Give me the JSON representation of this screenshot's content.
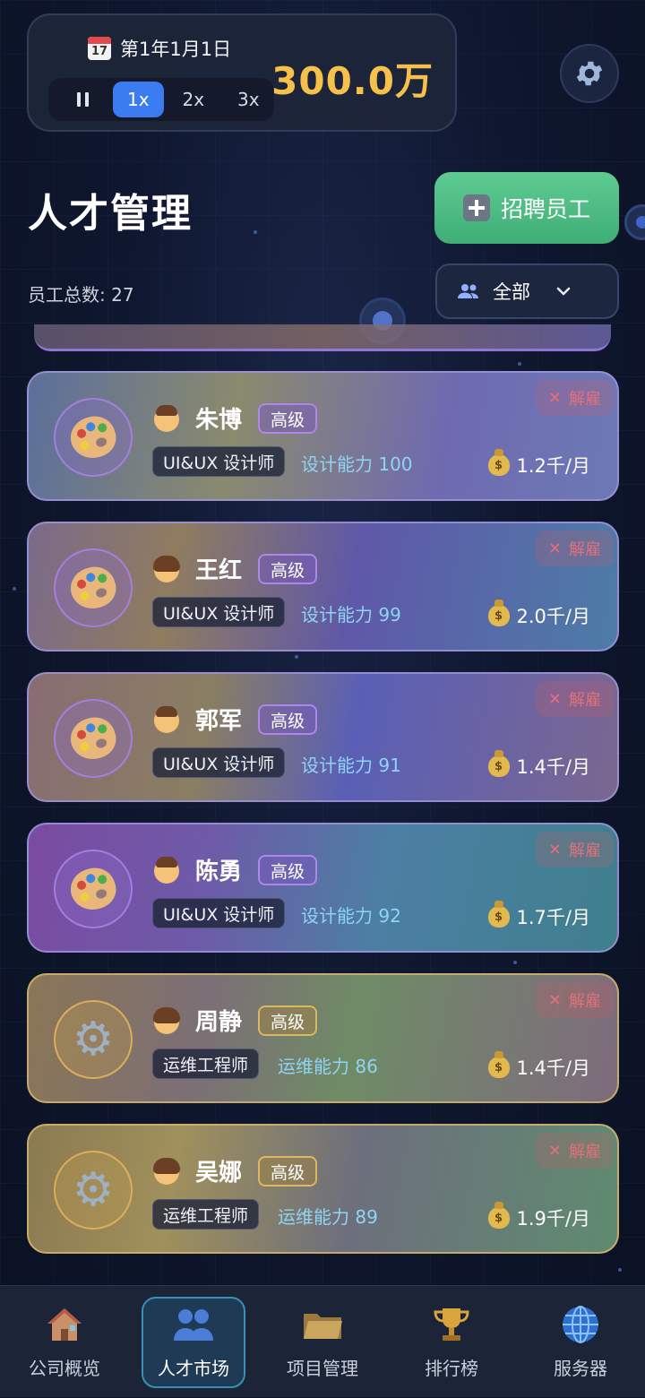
{
  "header": {
    "date": "第1年1月1日",
    "calendar_icon_text": "JULY 17",
    "speeds": [
      "1x",
      "2x",
      "3x"
    ],
    "active_speed": "1x",
    "money": "300.0万"
  },
  "page": {
    "title": "人才管理",
    "recruit_label": "招聘员工",
    "employee_count": "员工总数: 27",
    "filter_label": "全部"
  },
  "employees": [
    {
      "name": "朱博",
      "level": "高级",
      "role": "UI&UX 设计师",
      "skill": "设计能力 100",
      "salary": "1.2千/月",
      "fire": "解雇",
      "gender": "male",
      "icon": "palette-icon"
    },
    {
      "name": "王红",
      "level": "高级",
      "role": "UI&UX 设计师",
      "skill": "设计能力 99",
      "salary": "2.0千/月",
      "fire": "解雇",
      "gender": "female",
      "icon": "palette-icon"
    },
    {
      "name": "郭军",
      "level": "高级",
      "role": "UI&UX 设计师",
      "skill": "设计能力 91",
      "salary": "1.4千/月",
      "fire": "解雇",
      "gender": "male",
      "icon": "palette-icon"
    },
    {
      "name": "陈勇",
      "level": "高级",
      "role": "UI&UX 设计师",
      "skill": "设计能力 92",
      "salary": "1.7千/月",
      "fire": "解雇",
      "gender": "male",
      "icon": "palette-icon"
    },
    {
      "name": "周静",
      "level": "高级",
      "role": "运维工程师",
      "skill": "运维能力 86",
      "salary": "1.4千/月",
      "fire": "解雇",
      "gender": "female",
      "icon": "gear-icon"
    },
    {
      "name": "吴娜",
      "level": "高级",
      "role": "运维工程师",
      "skill": "运维能力 89",
      "salary": "1.9千/月",
      "fire": "解雇",
      "gender": "female",
      "icon": "gear-icon"
    }
  ],
  "nav": [
    {
      "label": "公司概览",
      "icon": "house-icon"
    },
    {
      "label": "人才市场",
      "icon": "people-icon",
      "active": true
    },
    {
      "label": "项目管理",
      "icon": "folder-icon"
    },
    {
      "label": "排行榜",
      "icon": "trophy-icon"
    },
    {
      "label": "服务器",
      "icon": "globe-icon"
    }
  ],
  "colors": {
    "accent": "#3b7cf0",
    "money": "#f6c04a",
    "recruit": "#4fbd84",
    "skill": "#8ed5f5",
    "fire": "#e2707a"
  }
}
